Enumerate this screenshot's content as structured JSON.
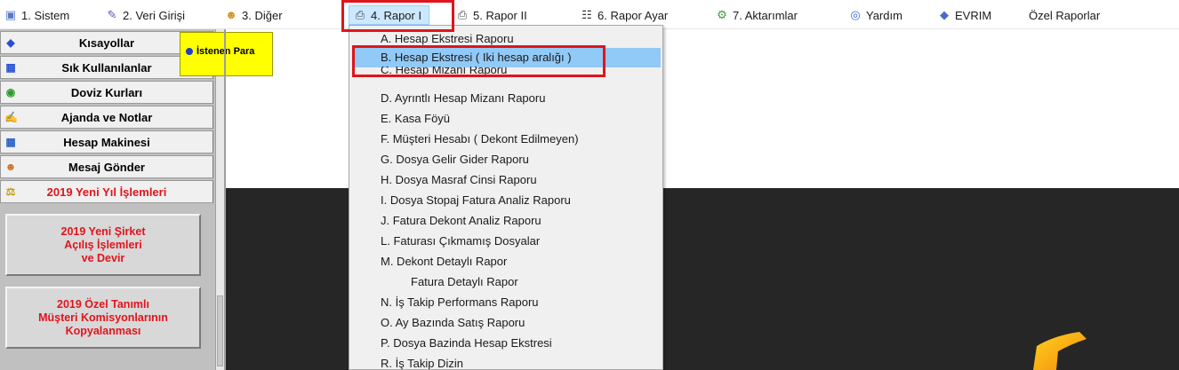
{
  "menubar": {
    "items": [
      {
        "label": "1.  Sistem",
        "icon": "computer-icon"
      },
      {
        "label": "2.  Veri Girişi",
        "icon": "pencil-icon"
      },
      {
        "label": "3.  Diğer",
        "icon": "people-icon"
      },
      {
        "label": "4.  Rapor I",
        "icon": "printer-icon"
      },
      {
        "label": "5.  Rapor II",
        "icon": "printer-icon"
      },
      {
        "label": "6.  Rapor Ayar",
        "icon": "keyboard-icon"
      },
      {
        "label": "7.  Aktarımlar",
        "icon": "gears-icon"
      },
      {
        "label": "Yardım",
        "icon": "help-icon"
      },
      {
        "label": "EVRIM",
        "icon": "tag-icon"
      },
      {
        "label": "Özel Raporlar",
        "icon": ""
      }
    ],
    "active_index": 3
  },
  "shortcuts": {
    "items": [
      {
        "label": "Kısayollar",
        "icon": "diamond-icon"
      },
      {
        "label": "Sık Kullanılanlar",
        "icon": "document-icon"
      },
      {
        "label": "Doviz Kurları",
        "icon": "currency-icon"
      },
      {
        "label": "Ajanda ve Notlar",
        "icon": "notebook-icon"
      },
      {
        "label": "Hesap Makinesi",
        "icon": "calculator-icon"
      },
      {
        "label": "Mesaj Gönder",
        "icon": "users-icon"
      },
      {
        "label": "2019 Yeni Yıl İşlemleri",
        "icon": "balance-icon"
      }
    ],
    "buttons": [
      {
        "lines": [
          "2019 Yeni Şirket",
          "Açılış İşlemleri",
          "ve Devir"
        ]
      },
      {
        "lines": [
          "2019 Özel Tanımlı",
          "Müşteri Komisyonlarının",
          "Kopyalanması"
        ]
      }
    ]
  },
  "tooltip": {
    "text": "İstenen Para"
  },
  "dropdown": {
    "items": [
      {
        "label": "A.  Hesap Ekstresi Raporu"
      },
      {
        "label": "B.  Hesap Ekstresi ( Iki hesap aralığı )"
      },
      {
        "label": "C.  Hesap Mizanı Raporu"
      },
      {
        "label": "D.  Ayrıntlı Hesap Mizanı Raporu"
      },
      {
        "label": "E.  Kasa Föyü"
      },
      {
        "label": "F.  Müşteri Hesabı ( Dekont Edilmeyen)"
      },
      {
        "label": "G.  Dosya Gelir Gider Raporu"
      },
      {
        "label": "H.  Dosya Masraf Cinsi Raporu"
      },
      {
        "label": "I.  Dosya Stopaj Fatura Analiz Raporu"
      },
      {
        "label": "J.  Fatura Dekont Analiz Raporu"
      },
      {
        "label": "L.  Faturası Çıkmamış Dosyalar"
      },
      {
        "label": "M.   Dekont Detaylı Rapor"
      },
      {
        "label": "Fatura Detaylı Rapor"
      },
      {
        "label": "N.  İş Takip Performans Raporu"
      },
      {
        "label": "O.  Ay Bazında Satış Raporu"
      },
      {
        "label": "P.  Dosya Bazinda Hesap Ekstresi"
      },
      {
        "label": "R.  İş Takip Dizin"
      }
    ],
    "selected_index": 1
  },
  "colors": {
    "highlight": "#e0141c",
    "selection": "#91c9f7",
    "tooltip": "#ffff00",
    "dark_area": "#262626"
  }
}
